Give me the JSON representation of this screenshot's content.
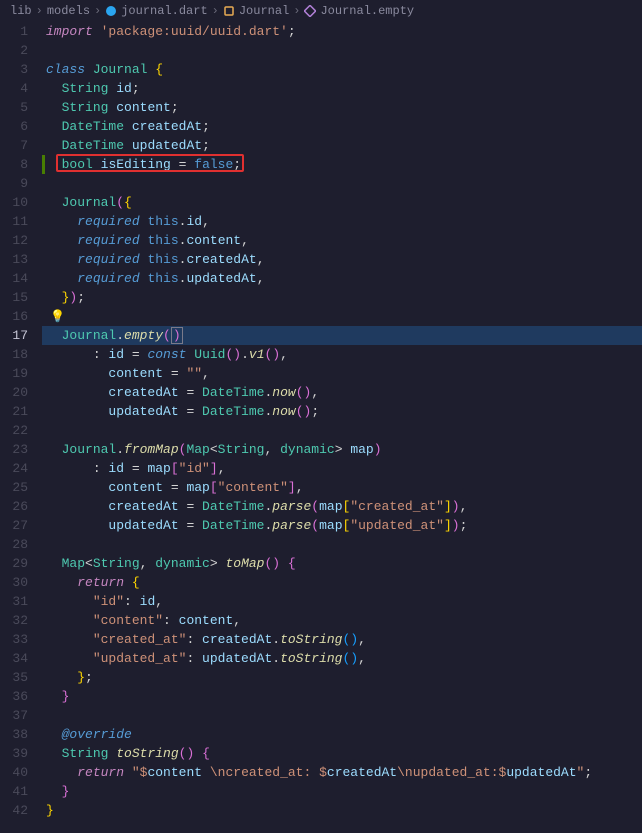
{
  "breadcrumb": {
    "items": [
      {
        "label": "lib",
        "icon": ""
      },
      {
        "label": "models",
        "icon": ""
      },
      {
        "label": "journal.dart",
        "icon": "dart"
      },
      {
        "label": "Journal",
        "icon": "class"
      },
      {
        "label": "Journal.empty",
        "icon": "method"
      }
    ],
    "sep": "›"
  },
  "active_line": 17,
  "highlight_box_line": 8,
  "lightbulb_line": 16,
  "git_marker_line": 8,
  "code": {
    "l1": {
      "tokens": [
        [
          "kw",
          "import"
        ],
        [
          "plain",
          " "
        ],
        [
          "str",
          "'package:uuid/uuid.dart'"
        ],
        [
          "plain",
          ";"
        ]
      ]
    },
    "l2": {
      "tokens": []
    },
    "l3": {
      "tokens": [
        [
          "kw2",
          "class"
        ],
        [
          "plain",
          " "
        ],
        [
          "type",
          "Journal"
        ],
        [
          "plain",
          " "
        ],
        [
          "punct",
          "{"
        ]
      ]
    },
    "l4": {
      "indent": 1,
      "tokens": [
        [
          "type",
          "String"
        ],
        [
          "plain",
          " "
        ],
        [
          "var",
          "id"
        ],
        [
          "plain",
          ";"
        ]
      ]
    },
    "l5": {
      "indent": 1,
      "tokens": [
        [
          "type",
          "String"
        ],
        [
          "plain",
          " "
        ],
        [
          "var",
          "content"
        ],
        [
          "plain",
          ";"
        ]
      ]
    },
    "l6": {
      "indent": 1,
      "tokens": [
        [
          "type",
          "DateTime"
        ],
        [
          "plain",
          " "
        ],
        [
          "var",
          "createdAt"
        ],
        [
          "plain",
          ";"
        ]
      ]
    },
    "l7": {
      "indent": 1,
      "tokens": [
        [
          "type",
          "DateTime"
        ],
        [
          "plain",
          " "
        ],
        [
          "var",
          "updatedAt"
        ],
        [
          "plain",
          ";"
        ]
      ]
    },
    "l8": {
      "indent": 1,
      "tokens": [
        [
          "type",
          "bool"
        ],
        [
          "plain",
          " "
        ],
        [
          "var",
          "isEditing"
        ],
        [
          "plain",
          " = "
        ],
        [
          "const",
          "false"
        ],
        [
          "plain",
          ";"
        ]
      ]
    },
    "l9": {
      "tokens": []
    },
    "l10": {
      "indent": 1,
      "tokens": [
        [
          "type",
          "Journal"
        ],
        [
          "punct2",
          "("
        ],
        [
          "punct",
          "{"
        ]
      ]
    },
    "l11": {
      "indent": 2,
      "tokens": [
        [
          "kw2",
          "required"
        ],
        [
          "plain",
          " "
        ],
        [
          "const",
          "this"
        ],
        [
          "plain",
          "."
        ],
        [
          "var",
          "id"
        ],
        [
          "plain",
          ","
        ]
      ]
    },
    "l12": {
      "indent": 2,
      "tokens": [
        [
          "kw2",
          "required"
        ],
        [
          "plain",
          " "
        ],
        [
          "const",
          "this"
        ],
        [
          "plain",
          "."
        ],
        [
          "var",
          "content"
        ],
        [
          "plain",
          ","
        ]
      ]
    },
    "l13": {
      "indent": 2,
      "tokens": [
        [
          "kw2",
          "required"
        ],
        [
          "plain",
          " "
        ],
        [
          "const",
          "this"
        ],
        [
          "plain",
          "."
        ],
        [
          "var",
          "createdAt"
        ],
        [
          "plain",
          ","
        ]
      ]
    },
    "l14": {
      "indent": 2,
      "tokens": [
        [
          "kw2",
          "required"
        ],
        [
          "plain",
          " "
        ],
        [
          "const",
          "this"
        ],
        [
          "plain",
          "."
        ],
        [
          "var",
          "updatedAt"
        ],
        [
          "plain",
          ","
        ]
      ]
    },
    "l15": {
      "indent": 1,
      "tokens": [
        [
          "punct",
          "}"
        ],
        [
          "punct2",
          ")"
        ],
        [
          "plain",
          ";"
        ]
      ]
    },
    "l16": {
      "tokens": []
    },
    "l17": {
      "indent": 1,
      "tokens": [
        [
          "type",
          "Journal"
        ],
        [
          "plain",
          "."
        ],
        [
          "fn",
          "empty"
        ],
        [
          "punct2",
          "("
        ],
        [
          "punct2",
          ")"
        ]
      ]
    },
    "l18": {
      "indent": 3,
      "tokens": [
        [
          "plain",
          ": "
        ],
        [
          "var",
          "id"
        ],
        [
          "plain",
          " = "
        ],
        [
          "kw2",
          "const"
        ],
        [
          "plain",
          " "
        ],
        [
          "type",
          "Uuid"
        ],
        [
          "punct2",
          "("
        ],
        [
          "punct2",
          ")"
        ],
        [
          "plain",
          "."
        ],
        [
          "fn",
          "v1"
        ],
        [
          "punct2",
          "("
        ],
        [
          "punct2",
          ")"
        ],
        [
          "plain",
          ","
        ]
      ]
    },
    "l19": {
      "indent": 4,
      "tokens": [
        [
          "var",
          "content"
        ],
        [
          "plain",
          " = "
        ],
        [
          "str",
          "\"\""
        ],
        [
          "plain",
          ","
        ]
      ]
    },
    "l20": {
      "indent": 4,
      "tokens": [
        [
          "var",
          "createdAt"
        ],
        [
          "plain",
          " = "
        ],
        [
          "type",
          "DateTime"
        ],
        [
          "plain",
          "."
        ],
        [
          "fn",
          "now"
        ],
        [
          "punct2",
          "("
        ],
        [
          "punct2",
          ")"
        ],
        [
          "plain",
          ","
        ]
      ]
    },
    "l21": {
      "indent": 4,
      "tokens": [
        [
          "var",
          "updatedAt"
        ],
        [
          "plain",
          " = "
        ],
        [
          "type",
          "DateTime"
        ],
        [
          "plain",
          "."
        ],
        [
          "fn",
          "now"
        ],
        [
          "punct2",
          "("
        ],
        [
          "punct2",
          ")"
        ],
        [
          "plain",
          ";"
        ]
      ]
    },
    "l22": {
      "tokens": []
    },
    "l23": {
      "indent": 1,
      "tokens": [
        [
          "type",
          "Journal"
        ],
        [
          "plain",
          "."
        ],
        [
          "fn",
          "fromMap"
        ],
        [
          "punct2",
          "("
        ],
        [
          "type",
          "Map"
        ],
        [
          "plain",
          "<"
        ],
        [
          "type",
          "String"
        ],
        [
          "plain",
          ", "
        ],
        [
          "type",
          "dynamic"
        ],
        [
          "plain",
          "> "
        ],
        [
          "var",
          "map"
        ],
        [
          "punct2",
          ")"
        ]
      ]
    },
    "l24": {
      "indent": 3,
      "tokens": [
        [
          "plain",
          ": "
        ],
        [
          "var",
          "id"
        ],
        [
          "plain",
          " = "
        ],
        [
          "var",
          "map"
        ],
        [
          "punct2",
          "["
        ],
        [
          "str",
          "\"id\""
        ],
        [
          "punct2",
          "]"
        ],
        [
          "plain",
          ","
        ]
      ]
    },
    "l25": {
      "indent": 4,
      "tokens": [
        [
          "var",
          "content"
        ],
        [
          "plain",
          " = "
        ],
        [
          "var",
          "map"
        ],
        [
          "punct2",
          "["
        ],
        [
          "str",
          "\"content\""
        ],
        [
          "punct2",
          "]"
        ],
        [
          "plain",
          ","
        ]
      ]
    },
    "l26": {
      "indent": 4,
      "tokens": [
        [
          "var",
          "createdAt"
        ],
        [
          "plain",
          " = "
        ],
        [
          "type",
          "DateTime"
        ],
        [
          "plain",
          "."
        ],
        [
          "fn",
          "parse"
        ],
        [
          "punct2",
          "("
        ],
        [
          "var",
          "map"
        ],
        [
          "punct",
          "["
        ],
        [
          "str",
          "\"created_at\""
        ],
        [
          "punct",
          "]"
        ],
        [
          "punct2",
          ")"
        ],
        [
          "plain",
          ","
        ]
      ]
    },
    "l27": {
      "indent": 4,
      "tokens": [
        [
          "var",
          "updatedAt"
        ],
        [
          "plain",
          " = "
        ],
        [
          "type",
          "DateTime"
        ],
        [
          "plain",
          "."
        ],
        [
          "fn",
          "parse"
        ],
        [
          "punct2",
          "("
        ],
        [
          "var",
          "map"
        ],
        [
          "punct",
          "["
        ],
        [
          "str",
          "\"updated_at\""
        ],
        [
          "punct",
          "]"
        ],
        [
          "punct2",
          ")"
        ],
        [
          "plain",
          ";"
        ]
      ]
    },
    "l28": {
      "tokens": []
    },
    "l29": {
      "indent": 1,
      "tokens": [
        [
          "type",
          "Map"
        ],
        [
          "plain",
          "<"
        ],
        [
          "type",
          "String"
        ],
        [
          "plain",
          ", "
        ],
        [
          "type",
          "dynamic"
        ],
        [
          "plain",
          "> "
        ],
        [
          "fn",
          "toMap"
        ],
        [
          "punct2",
          "("
        ],
        [
          "punct2",
          ")"
        ],
        [
          "plain",
          " "
        ],
        [
          "punct2",
          "{"
        ]
      ]
    },
    "l30": {
      "indent": 2,
      "tokens": [
        [
          "kw",
          "return"
        ],
        [
          "plain",
          " "
        ],
        [
          "punct",
          "{"
        ]
      ]
    },
    "l31": {
      "indent": 3,
      "tokens": [
        [
          "str",
          "\"id\""
        ],
        [
          "plain",
          ": "
        ],
        [
          "var",
          "id"
        ],
        [
          "plain",
          ","
        ]
      ]
    },
    "l32": {
      "indent": 3,
      "tokens": [
        [
          "str",
          "\"content\""
        ],
        [
          "plain",
          ": "
        ],
        [
          "var",
          "content"
        ],
        [
          "plain",
          ","
        ]
      ]
    },
    "l33": {
      "indent": 3,
      "tokens": [
        [
          "str",
          "\"created_at\""
        ],
        [
          "plain",
          ": "
        ],
        [
          "var",
          "createdAt"
        ],
        [
          "plain",
          "."
        ],
        [
          "fn",
          "toString"
        ],
        [
          "punct3",
          "("
        ],
        [
          "punct3",
          ")"
        ],
        [
          "plain",
          ","
        ]
      ]
    },
    "l34": {
      "indent": 3,
      "tokens": [
        [
          "str",
          "\"updated_at\""
        ],
        [
          "plain",
          ": "
        ],
        [
          "var",
          "updatedAt"
        ],
        [
          "plain",
          "."
        ],
        [
          "fn",
          "toString"
        ],
        [
          "punct3",
          "("
        ],
        [
          "punct3",
          ")"
        ],
        [
          "plain",
          ","
        ]
      ]
    },
    "l35": {
      "indent": 2,
      "tokens": [
        [
          "punct",
          "}"
        ],
        [
          "plain",
          ";"
        ]
      ]
    },
    "l36": {
      "indent": 1,
      "tokens": [
        [
          "punct2",
          "}"
        ]
      ]
    },
    "l37": {
      "tokens": []
    },
    "l38": {
      "indent": 1,
      "tokens": [
        [
          "anno",
          "@override"
        ]
      ]
    },
    "l39": {
      "indent": 1,
      "tokens": [
        [
          "type",
          "String"
        ],
        [
          "plain",
          " "
        ],
        [
          "fn",
          "toString"
        ],
        [
          "punct2",
          "("
        ],
        [
          "punct2",
          ")"
        ],
        [
          "plain",
          " "
        ],
        [
          "punct2",
          "{"
        ]
      ]
    },
    "l40": {
      "indent": 2,
      "tokens": [
        [
          "kw",
          "return"
        ],
        [
          "plain",
          " "
        ],
        [
          "str",
          "\"$"
        ],
        [
          "var",
          "content"
        ],
        [
          "str",
          " \\ncreated_at: $"
        ],
        [
          "var",
          "createdAt"
        ],
        [
          "str",
          "\\nupdated_at:$"
        ],
        [
          "var",
          "updatedAt"
        ],
        [
          "str",
          "\""
        ],
        [
          "plain",
          ";"
        ]
      ]
    },
    "l41": {
      "indent": 1,
      "tokens": [
        [
          "punct2",
          "}"
        ]
      ]
    },
    "l42": {
      "tokens": [
        [
          "punct",
          "}"
        ]
      ]
    }
  },
  "line_count": 42
}
